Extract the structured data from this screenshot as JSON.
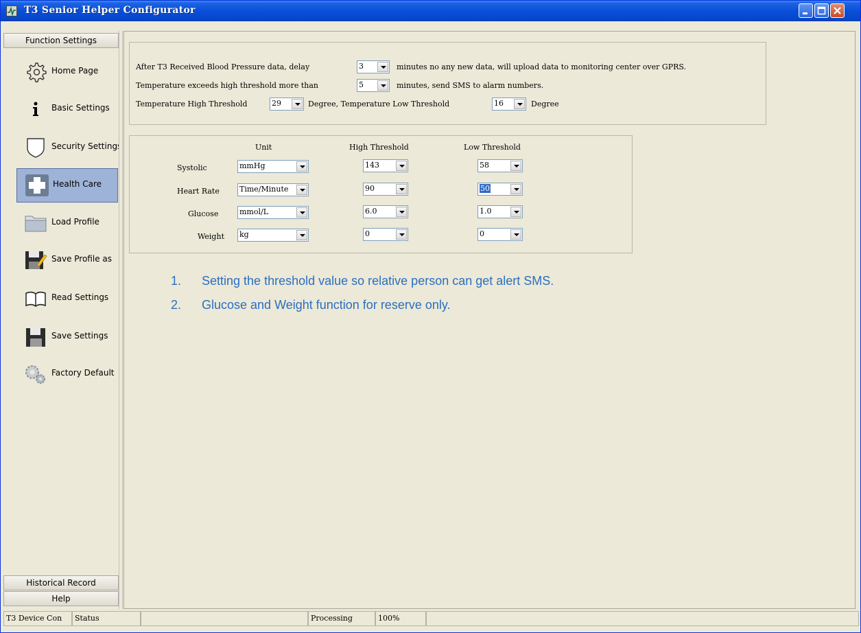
{
  "window": {
    "title": "T3 Senior Helper Configurator",
    "title_color": "#0a4fd8",
    "close_color": "#c84b2b"
  },
  "sidebar": {
    "top_header": "Function Settings",
    "items": [
      {
        "label": "Home Page",
        "icon": "gear-icon"
      },
      {
        "label": "Basic  Settings",
        "icon": "info-icon"
      },
      {
        "label": "Security Settings",
        "icon": "shield-icon"
      },
      {
        "label": "Health   Care",
        "icon": "medical-cross-icon",
        "active": true
      },
      {
        "label": "Load    Profile",
        "icon": "folder-icon"
      },
      {
        "label": "Save Profile as",
        "icon": "save-as-icon"
      },
      {
        "label": "Read Settings",
        "icon": "book-icon"
      },
      {
        "label": "Save Settings",
        "icon": "floppy-icon"
      },
      {
        "label": "Factory Default",
        "icon": "gears-icon"
      }
    ],
    "bottom_headers": [
      "Historical Record",
      "Help"
    ]
  },
  "upload": {
    "line1_prefix": "After T3 Received Blood Pressure data, delay",
    "delay_value": "3",
    "line1_suffix": "minutes no any new data, will upload data to monitoring center over GPRS.",
    "line2_prefix": "Temperature exceeds high threshold more than",
    "temp_minutes": "5",
    "line2_suffix": "minutes,  send SMS to alarm numbers.",
    "line3_high_label": "Temperature High Threshold",
    "temp_high": "29",
    "line3_mid": "Degree,   Temperature Low Threshold",
    "temp_low": "16",
    "line3_suffix": "Degree"
  },
  "thresholds": {
    "headers": {
      "unit": "Unit",
      "high": "High Threshold",
      "low": "Low Threshold"
    },
    "rows": [
      {
        "name": "Systolic",
        "unit": "mmHg",
        "high": "143",
        "low": "58"
      },
      {
        "name": "Heart Rate",
        "unit": "Time/Minute",
        "high": "90",
        "low": "50",
        "low_selected": true
      },
      {
        "name": "Glucose",
        "unit": "mmol/L",
        "high": "6.0",
        "low": "1.0"
      },
      {
        "name": "Weight",
        "unit": "kg",
        "high": "0",
        "low": "0"
      }
    ]
  },
  "notes": [
    {
      "num": "1.",
      "text": "Setting the threshold value so relative person can get alert SMS."
    },
    {
      "num": "2.",
      "text": "Glucose and Weight function for reserve only."
    }
  ],
  "note_color": "#2a6fc0",
  "status": {
    "device": "T3 Device Con",
    "status_label": "Status",
    "blank": "",
    "processing": "Processing",
    "percent": "100%",
    "tail": ""
  }
}
